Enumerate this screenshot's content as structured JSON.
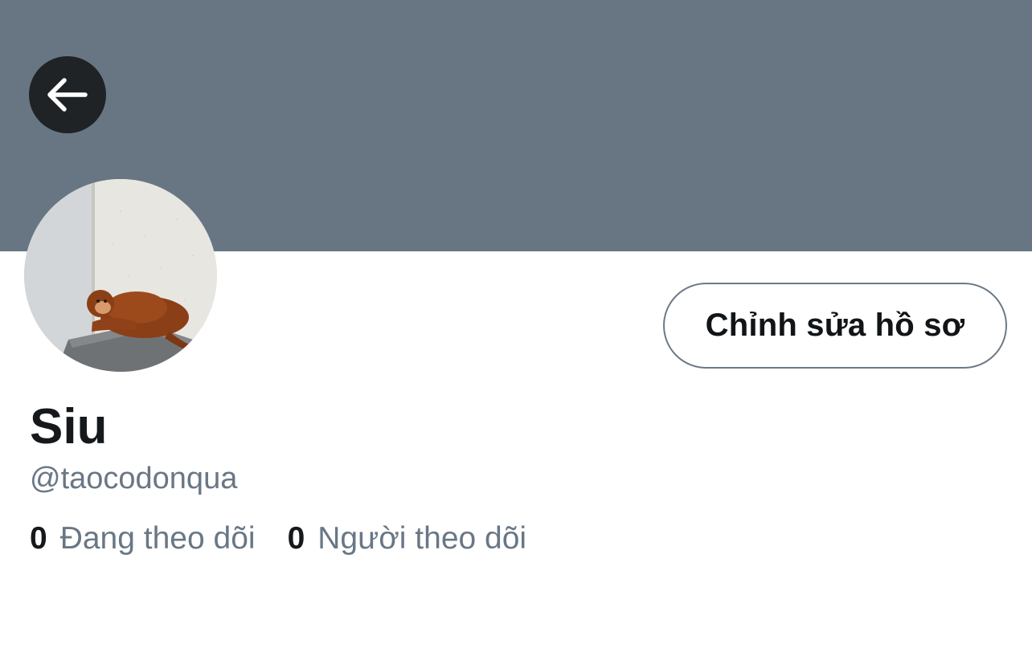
{
  "header": {
    "banner_color": "#687684",
    "back_icon": "arrow-left-icon"
  },
  "profile": {
    "avatar": "profile-photo-plush-orangutan",
    "name": "Siu",
    "handle": "@taocodonqua",
    "edit_button_label": "Chỉnh sửa hồ sơ"
  },
  "stats": {
    "following_count": "0",
    "following_label": "Đang theo dõi",
    "followers_count": "0",
    "followers_label": "Người theo dõi"
  },
  "colors": {
    "text_primary": "#16191c",
    "text_secondary": "#697785",
    "button_border": "#6d7a86"
  }
}
